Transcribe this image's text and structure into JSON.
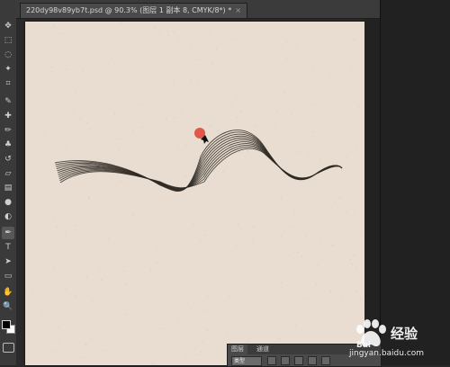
{
  "document": {
    "tab_title": "220dy98v89yb7t.psd @ 90.3% (图层 1 副本 8, CMYK/8*) *",
    "close_glyph": "×",
    "canvas_color": "#e8ddd0"
  },
  "toolbox": {
    "tools": [
      {
        "name": "move-tool-icon",
        "glyph": "✥"
      },
      {
        "name": "marquee-tool-icon",
        "glyph": "⬚"
      },
      {
        "name": "lasso-tool-icon",
        "glyph": "◌"
      },
      {
        "name": "magic-wand-tool-icon",
        "glyph": "✦"
      },
      {
        "name": "crop-tool-icon",
        "glyph": "⌗"
      },
      {
        "name": "eyedropper-tool-icon",
        "glyph": "✎"
      },
      {
        "name": "healing-brush-tool-icon",
        "glyph": "✚"
      },
      {
        "name": "brush-tool-icon",
        "glyph": "✏"
      },
      {
        "name": "clone-stamp-tool-icon",
        "glyph": "♣"
      },
      {
        "name": "history-brush-tool-icon",
        "glyph": "↺"
      },
      {
        "name": "eraser-tool-icon",
        "glyph": "▱"
      },
      {
        "name": "gradient-tool-icon",
        "glyph": "▤"
      },
      {
        "name": "blur-tool-icon",
        "glyph": "●"
      },
      {
        "name": "dodge-tool-icon",
        "glyph": "◐"
      },
      {
        "name": "pen-tool-icon",
        "glyph": "✒"
      },
      {
        "name": "type-tool-icon",
        "glyph": "T"
      },
      {
        "name": "path-selection-tool-icon",
        "glyph": "➤"
      },
      {
        "name": "shape-tool-icon",
        "glyph": "▭"
      },
      {
        "name": "hand-tool-icon",
        "glyph": "✋"
      },
      {
        "name": "zoom-tool-icon",
        "glyph": "🔍"
      }
    ],
    "active_tool": "pen-tool-icon",
    "foreground_color": "#000000",
    "background_color": "#ffffff"
  },
  "layers_panel": {
    "tabs": [
      "图层",
      "通道"
    ],
    "kind_label": "类型"
  },
  "artwork": {
    "stroke_color": "#2f2a25",
    "sun_color": "#e0584a"
  },
  "watermark": {
    "brand": "经验",
    "url": "jingyan.baidu.com"
  }
}
